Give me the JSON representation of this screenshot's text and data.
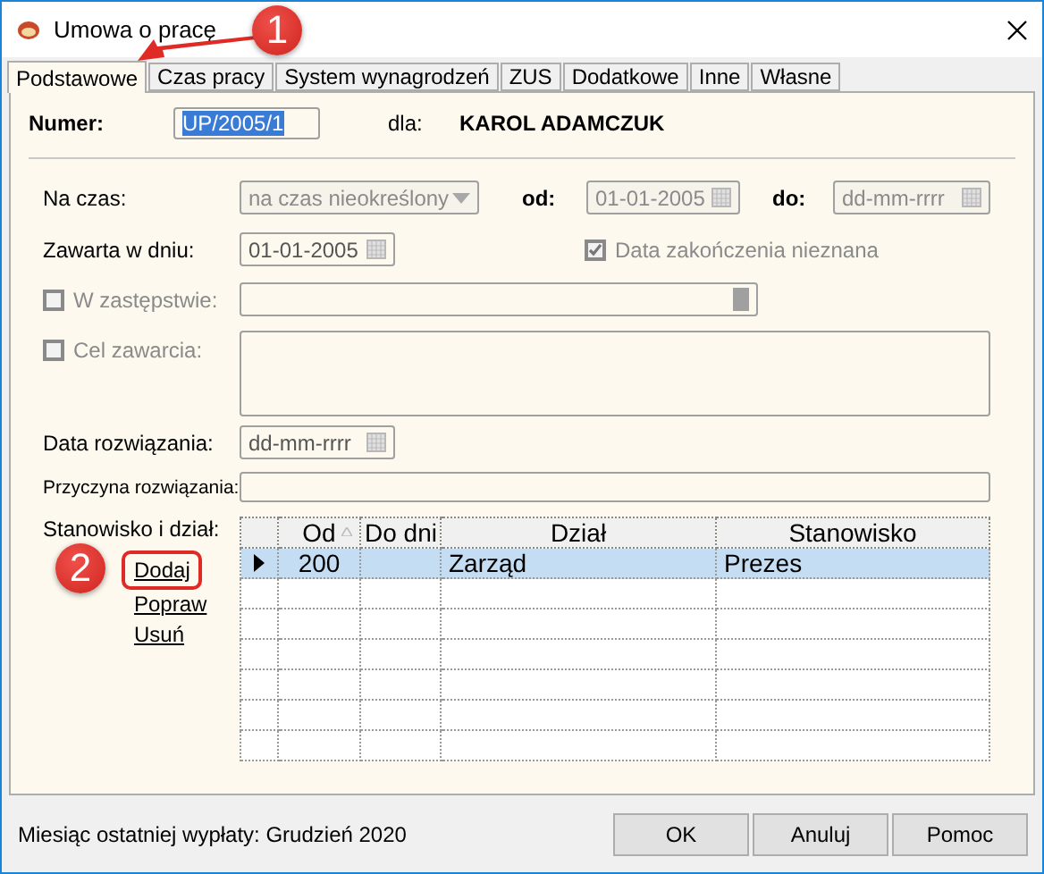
{
  "window": {
    "title": "Umowa o pracę"
  },
  "tabs": [
    {
      "label": "Podstawowe",
      "selected": true
    },
    {
      "label": "Czas pracy",
      "selected": false
    },
    {
      "label": "System wynagrodzeń",
      "selected": false
    },
    {
      "label": "ZUS",
      "selected": false
    },
    {
      "label": "Dodatkowe",
      "selected": false
    },
    {
      "label": "Inne",
      "selected": false
    },
    {
      "label": "Własne",
      "selected": false
    }
  ],
  "numer": {
    "label": "Numer:",
    "value": "UP/2005/1",
    "value_selected": true
  },
  "employee": {
    "label": "dla:",
    "name": "KAROL ADAMCZUK"
  },
  "na_czas": {
    "label": "Na czas:",
    "select": {
      "value": "na czas nieokreślony",
      "disabled": true
    },
    "from": {
      "label": "od:",
      "value": "01-01-2005",
      "disabled": true
    },
    "to": {
      "label": "do:",
      "placeholder": "dd-mm-rrrr",
      "disabled": true
    }
  },
  "zawarta": {
    "label": "Zawarta w dniu:",
    "value": "01-01-2005",
    "disabled": false
  },
  "end_unknown": {
    "label": "Data zakończenia nieznana",
    "checked": true,
    "disabled": true
  },
  "zastepstwo": {
    "label": "W zastępstwie:",
    "checked": false,
    "disabled": true
  },
  "cel": {
    "label": "Cel zawarcia:",
    "checked": false,
    "disabled": true
  },
  "rozwiazanie": {
    "label": "Data rozwiązania:",
    "placeholder": "dd-mm-rrrr",
    "disabled": false
  },
  "przyczyna": {
    "label": "Przyczyna rozwiązania:"
  },
  "positions": {
    "label": "Stanowisko i dział:",
    "links": [
      {
        "label": "Dodaj",
        "highlighted": true
      },
      {
        "label": "Popraw",
        "highlighted": false
      },
      {
        "label": "Usuń",
        "highlighted": false
      }
    ],
    "table": {
      "columns": [
        {
          "label": "Od",
          "sorted": true
        },
        {
          "label": "Do dni",
          "sorted": false
        },
        {
          "label": "Dział",
          "sorted": false
        },
        {
          "label": "Stanowisko",
          "sorted": false
        }
      ],
      "rows": [
        {
          "od": "200",
          "dzial": "Zarząd",
          "stanowisko": "Prezes",
          "selected": true
        }
      ]
    }
  },
  "status": "Miesiąc ostatniej wypłaty: Grudzień 2020",
  "buttons": [
    "OK",
    "Anuluj",
    "Pomoc"
  ],
  "annotations": [
    {
      "number": "1",
      "kind": "arrow"
    },
    {
      "number": "2",
      "kind": "marker"
    }
  ]
}
